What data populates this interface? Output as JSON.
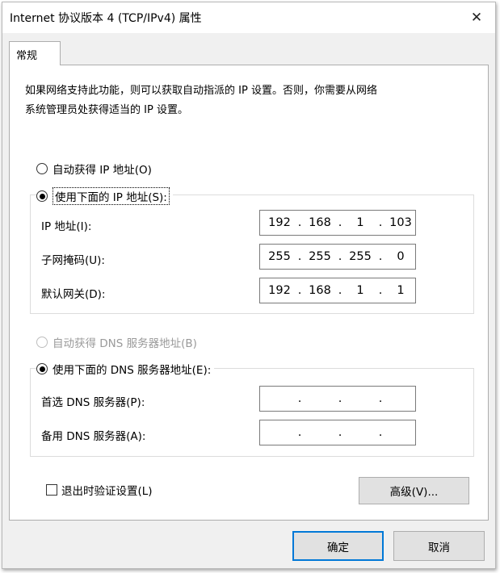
{
  "window": {
    "title": "Internet 协议版本 4 (TCP/IPv4) 属性",
    "close_glyph": "✕"
  },
  "tabs": [
    {
      "label": "常规"
    }
  ],
  "description": {
    "line1": "如果网络支持此功能，则可以获取自动指派的 IP 设置。否则，你需要从网络",
    "line2": "系统管理员处获得适当的 IP 设置。"
  },
  "ip_mode": {
    "auto_label": "自动获得 IP 地址(O)",
    "manual_label": "使用下面的 IP 地址(S):",
    "selected": "manual",
    "fields": [
      {
        "label": "IP 地址(I):",
        "octets": [
          "192",
          "168",
          "1",
          "103"
        ]
      },
      {
        "label": "子网掩码(U):",
        "octets": [
          "255",
          "255",
          "255",
          "0"
        ]
      },
      {
        "label": "默认网关(D):",
        "octets": [
          "192",
          "168",
          "1",
          "1"
        ]
      }
    ]
  },
  "dns_mode": {
    "auto_label": "自动获得 DNS 服务器地址(B)",
    "manual_label": "使用下面的 DNS 服务器地址(E):",
    "selected": "manual",
    "auto_enabled": false,
    "fields": [
      {
        "label": "首选 DNS 服务器(P):",
        "octets": [
          "",
          "",
          "",
          ""
        ]
      },
      {
        "label": "备用 DNS 服务器(A):",
        "octets": [
          "",
          "",
          "",
          ""
        ]
      }
    ]
  },
  "validate": {
    "label": "退出时验证设置(L)",
    "checked": false
  },
  "buttons": {
    "advanced": "高级(V)...",
    "ok": "确定",
    "cancel": "取消"
  },
  "ip_separator": "."
}
